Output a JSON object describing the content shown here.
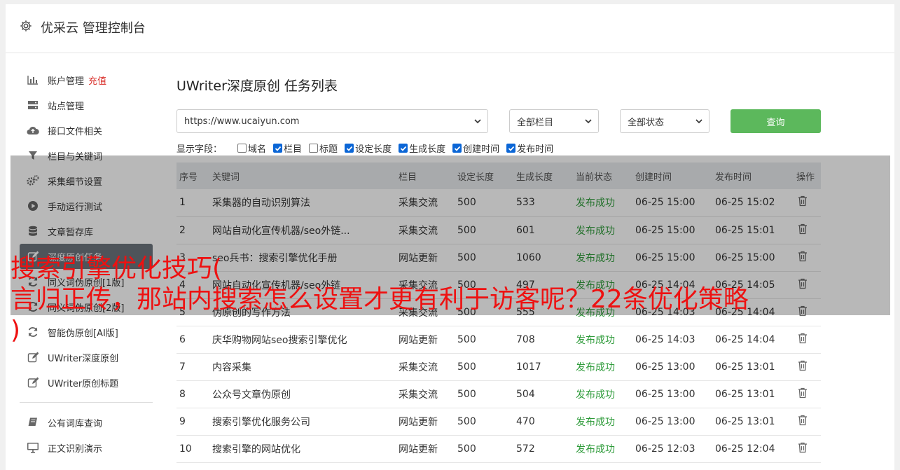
{
  "header": {
    "title": "优采云 管理控制台",
    "icon": "gear-icon"
  },
  "sidebar": {
    "items": [
      {
        "label": "账户管理",
        "extra": "充值",
        "icon": "bar-chart-icon"
      },
      {
        "label": "站点管理",
        "icon": "server-icon"
      },
      {
        "label": "接口文件相关",
        "icon": "cloud-upload-icon"
      },
      {
        "label": "栏目与关键词",
        "icon": "filter-icon"
      },
      {
        "label": "采集细节设置",
        "icon": "gears-icon"
      },
      {
        "label": "手动运行测试",
        "icon": "play-icon"
      },
      {
        "label": "文章暂存库",
        "icon": "database-icon"
      },
      {
        "label": "深度原创任务",
        "icon": "edit-icon",
        "active": true
      },
      {
        "label": "同义词伪原创[1版]",
        "icon": "refresh-icon"
      },
      {
        "label": "同义词伪原创[2版]",
        "icon": "refresh-icon"
      },
      {
        "label": "智能伪原创[AI版]",
        "icon": "refresh-icon"
      },
      {
        "label": "UWriter深度原创",
        "icon": "edit-icon"
      },
      {
        "label": "UWriter原创标题",
        "icon": "edit-icon"
      }
    ],
    "items2": [
      {
        "label": "公有词库查询",
        "icon": "book-icon"
      },
      {
        "label": "正文识别演示",
        "icon": "monitor-icon"
      }
    ]
  },
  "main": {
    "title": "UWriter深度原创 任务列表",
    "site_select": "https://www.ucaiyun.com",
    "column_select": "全部栏目",
    "status_select": "全部状态",
    "query_button": "查询",
    "fields_label": "显示字段：",
    "fields": [
      {
        "label": "域名",
        "checked": false
      },
      {
        "label": "栏目",
        "checked": true
      },
      {
        "label": "标题",
        "checked": false
      },
      {
        "label": "设定长度",
        "checked": true
      },
      {
        "label": "生成长度",
        "checked": true
      },
      {
        "label": "创建时间",
        "checked": true
      },
      {
        "label": "发布时间",
        "checked": true
      }
    ]
  },
  "table": {
    "headers": [
      "序号",
      "关键词",
      "栏目",
      "设定长度",
      "生成长度",
      "当前状态",
      "创建时间",
      "发布时间",
      "操作"
    ],
    "rows": [
      [
        "1",
        "采集器的自动识别算法",
        "采集交流",
        "500",
        "533",
        "发布成功",
        "06-25 15:00",
        "06-25 15:02"
      ],
      [
        "2",
        "网站自动化宣传机器/seo外链...",
        "采集交流",
        "500",
        "601",
        "发布成功",
        "06-25 15:00",
        "06-25 15:01"
      ],
      [
        "3",
        "seo兵书：搜索引擎优化手册",
        "网站更新",
        "500",
        "1060",
        "发布成功",
        "06-25 15:00",
        "06-25 15:00"
      ],
      [
        "4",
        "网站自动化宣传机器/seo外链...",
        "采集交流",
        "500",
        "497",
        "发布成功",
        "06-25 14:04",
        "06-25 14:05"
      ],
      [
        "5",
        "伪原创的写作方法",
        "采集交流",
        "500",
        "555",
        "发布成功",
        "06-25 14:03",
        "06-25 14:04"
      ],
      [
        "6",
        "庆华购物网站seo搜索引擎优化",
        "网站更新",
        "500",
        "708",
        "发布成功",
        "06-25 14:03",
        "06-25 14:04"
      ],
      [
        "7",
        "内容采集",
        "采集交流",
        "500",
        "1017",
        "发布成功",
        "06-25 13:00",
        "06-25 13:01"
      ],
      [
        "8",
        "公众号文章伪原创",
        "采集交流",
        "500",
        "504",
        "发布成功",
        "06-25 13:00",
        "06-25 13:01"
      ],
      [
        "9",
        "搜索引擎优化服务公司",
        "网站更新",
        "500",
        "470",
        "发布成功",
        "06-25 13:00",
        "06-25 13:01"
      ],
      [
        "10",
        "搜索引擎的网站优化",
        "网站更新",
        "500",
        "572",
        "发布成功",
        "06-25 12:03",
        "06-25 12:04"
      ]
    ]
  },
  "overlay_text": "搜索引擎优化技巧(\n言归正传，那站内搜索怎么设置才更有利于访客呢？22条优化策略\n)",
  "colors": {
    "status_ok": "#2e9b3a",
    "query_btn": "#5cb85c",
    "overlay_text": "#ee1111",
    "recharge": "#d9302b"
  }
}
